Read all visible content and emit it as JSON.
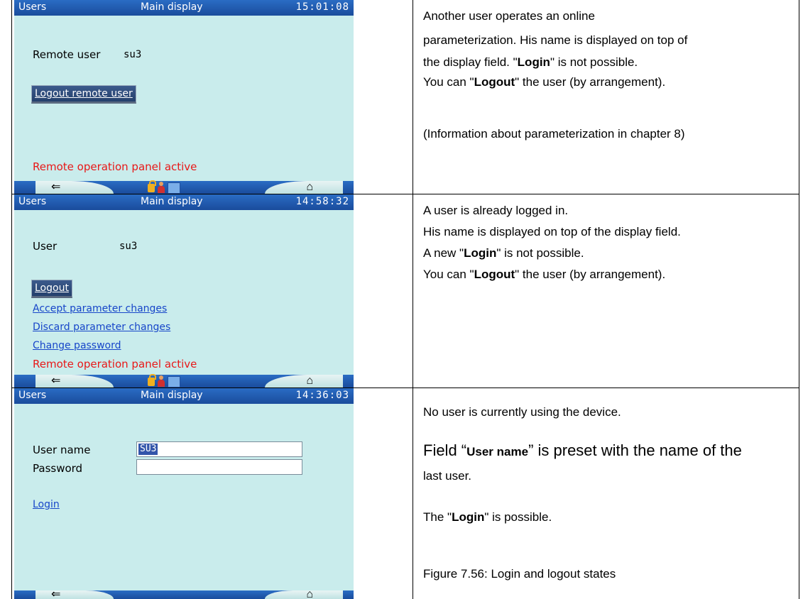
{
  "rows": [
    {
      "screen": {
        "title_left": "Users",
        "title_mid": "Main display",
        "time": "15:01:08",
        "label": "Remote user",
        "user_value": "su3",
        "button": "Logout remote user",
        "status": "Remote operation panel active"
      },
      "desc": [
        "Another user operates an online",
        "parameterization. His name is displayed on top of",
        "the display field. \"",
        "Login",
        "\" is not possible.",
        "You can \"",
        "Logout",
        "\" the user (by arrangement).",
        "(Information about parameterization in chapter 8)"
      ]
    },
    {
      "screen": {
        "title_left": "Users",
        "title_mid": "Main display",
        "time": "14:58:32",
        "label": "User",
        "user_value": "su3",
        "button": "Logout",
        "links": [
          "Accept parameter changes",
          "Discard parameter changes",
          "Change password"
        ],
        "status": "Remote operation panel active"
      },
      "desc": [
        "A user is already logged in.",
        "His name is displayed on top of the display field.",
        "A new \"",
        "Login",
        "\" is not possible.",
        "You can \"",
        "Logout",
        "\" the user (by arrangement)."
      ]
    },
    {
      "screen": {
        "title_left": "Users",
        "title_mid": "Main display",
        "time": "14:36:03",
        "username_label": "User name",
        "username_value": "SU3",
        "password_label": "Password",
        "login_link": "Login"
      },
      "desc": [
        "No user is currently using the device.",
        "Field “",
        "User name",
        "” is preset with the name of the",
        "last user.",
        "The \"",
        "Login",
        "\" is possible.",
        "Figure 7.56: Login and logout states"
      ]
    }
  ],
  "icons": {
    "back": "left-arrow-icon",
    "home": "home-icon",
    "lock": "unlocked-padlock-icon",
    "person": "user-icon",
    "monitor": "monitor-icon"
  }
}
